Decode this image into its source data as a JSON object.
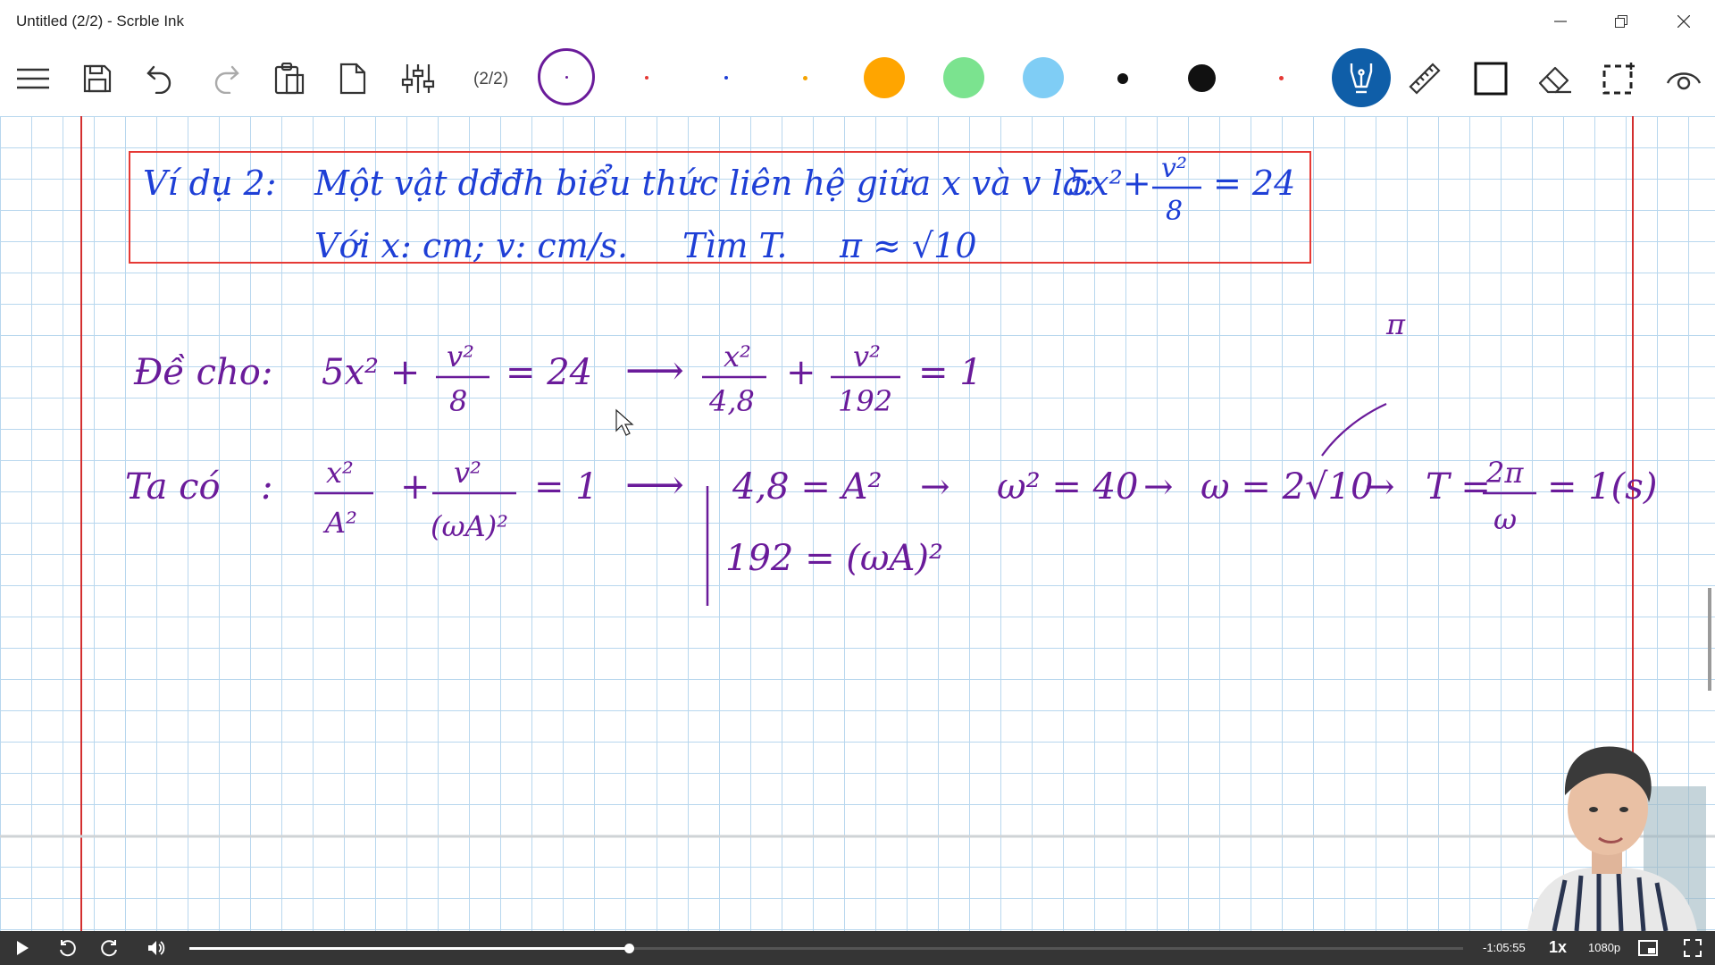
{
  "window": {
    "title": "Untitled (2/2) - Scrble Ink"
  },
  "toolbar": {
    "page_indicator": "(2/2)",
    "icons": [
      "menu-icon",
      "save-icon",
      "undo-icon",
      "redo-icon",
      "paste-icon",
      "page-icon",
      "settings-sliders-icon",
      "pen-icon",
      "ruler-icon",
      "shape-icon",
      "eraser-icon",
      "select-icon",
      "view-icon"
    ],
    "pen_colors": [
      "#6a1b9a",
      "#e53935",
      "#1e3fd6",
      "#f5a300",
      "#ffa500",
      "#7be38f",
      "#7fcdf5",
      "#111111",
      "#111111",
      "#e53935"
    ]
  },
  "canvas": {
    "example_box": {
      "line1": {
        "label": "Ví dụ 2:",
        "text": "Một vật dđđh biểu thức liên hệ giữa x và v là:",
        "eq_left": "5x²+",
        "frac_num": "v²",
        "frac_den": "8",
        "eq_right": "= 24"
      },
      "line2": {
        "units": "Với x: cm; v: cm/s.",
        "find": "Tìm T.",
        "approx": "π ≈ √10"
      }
    },
    "given": {
      "label": "Đề cho:",
      "lhs": "5x² +",
      "f1_num": "v²",
      "f1_den": "8",
      "eq": "= 24",
      "arrow": "⟶",
      "f2_num": "x²",
      "f2_den": "4,8",
      "plus": "+",
      "f3_num": "v²",
      "f3_den": "192",
      "rhs": "= 1"
    },
    "derivation": {
      "label": "Ta có",
      "colon": ":",
      "f1_num": "x²",
      "f1_den": "A²",
      "plus": "+",
      "f2_num": "v²",
      "f2_den": "(ωA)²",
      "eq1": "= 1",
      "arrow1": "⟶",
      "sys1": "4,8 = A²",
      "sys2": "192 = (ωA)²",
      "arrow2": "→",
      "omega_sq": "ω² = 40",
      "arrow3": "→",
      "omega": "ω = 2√10",
      "arrow4": "→",
      "T_lhs": "T =",
      "T_num": "2π",
      "T_den": "ω",
      "T_rhs": "= 1(s)",
      "note": "π"
    }
  },
  "video": {
    "time_remaining": "-1:05:55",
    "speed": "1x",
    "quality": "1080p",
    "progress": 0.345,
    "icons": [
      "play-icon",
      "replay-icon",
      "forward-icon",
      "volume-icon",
      "picture-in-picture-icon",
      "fullscreen-icon"
    ]
  }
}
